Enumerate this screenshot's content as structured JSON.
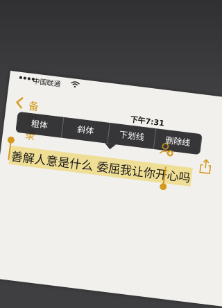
{
  "status_bar": {
    "carrier": "中国联通",
    "time": "下午7:31"
  },
  "nav": {
    "back_label": "备忘录"
  },
  "format_menu": {
    "items": [
      "粗体",
      "斜体",
      "下划线",
      "删除线"
    ]
  },
  "note": {
    "selected_text": "善解人意是什么 委屈我让你开心吗"
  },
  "colors": {
    "accent": "#d49a20",
    "selection": "#eed460",
    "menu_bg": "#28282a",
    "page_bg": "#f1f0ec"
  }
}
